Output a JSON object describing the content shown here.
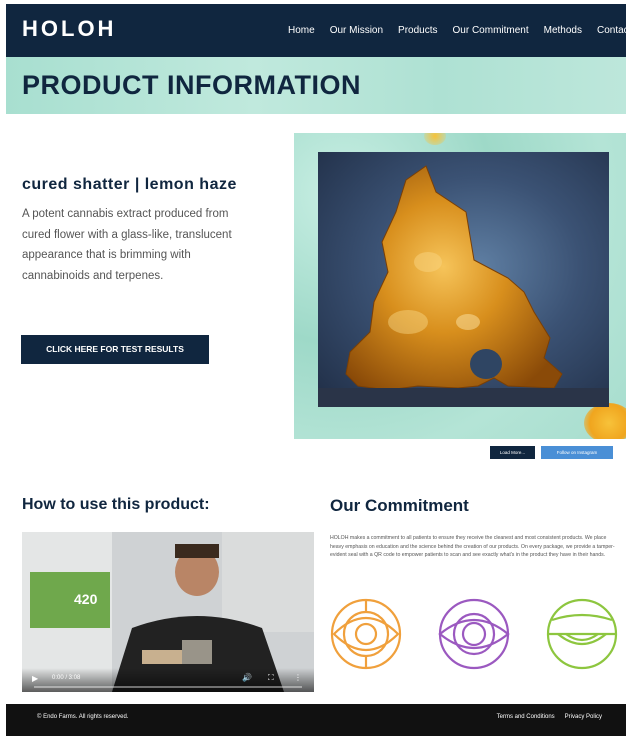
{
  "brand": {
    "logo_text": "HOLOH"
  },
  "nav": {
    "items": [
      "Home",
      "Our Mission",
      "Products",
      "Our Commitment",
      "Methods",
      "Contac"
    ]
  },
  "banner": {
    "title": "PRODUCT INFORMATION"
  },
  "product": {
    "title": "cured shatter | lemon haze",
    "description": "A potent cannabis extract produced from cured flower with a glass-like, translucent appearance that is brimming with cannabinoids and terpenes.",
    "cta_label": "CLICK HERE FOR TEST RESULTS"
  },
  "gallery_buttons": {
    "load_more": "Load More...",
    "follow": "Follow on Instagram"
  },
  "how_to": {
    "title": "How to use this product:",
    "video_time": "0:00 / 3:08"
  },
  "commitment": {
    "title": "Our Commitment",
    "text": "HOLOH makes a commitment to all patients to ensure they receive the cleanest and most consistent products. We place heavy emphasis on education and the science behind the creation of our products. On every package, we provide a tamper-evident seal with a QR code to empower patients to scan and see exactly what's in the product they have in their hands.",
    "icons": [
      {
        "name": "target-eye-icon",
        "color": "#f0a03c"
      },
      {
        "name": "eye-rings-icon",
        "color": "#9b59c0"
      },
      {
        "name": "globe-eye-icon",
        "color": "#8dc63f"
      }
    ]
  },
  "footer": {
    "copyright": "© Endo Farms. All rights reserved.",
    "links": [
      "Terms and Conditions",
      "Privacy Policy"
    ]
  },
  "colors": {
    "navy": "#10263f",
    "mint": "#aee1d3",
    "footer": "#111111"
  }
}
